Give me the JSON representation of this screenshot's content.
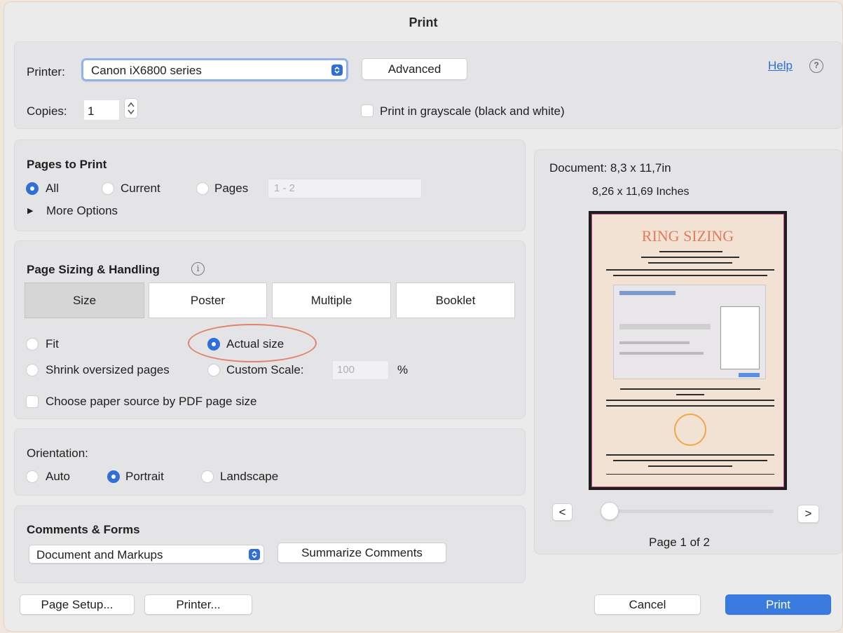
{
  "title": "Print",
  "printer": {
    "label": "Printer:",
    "value": "Canon iX6800 series",
    "advanced_label": "Advanced",
    "help_label": "Help",
    "help_icon": "question-circle-icon"
  },
  "copies": {
    "label": "Copies:",
    "value": "1",
    "grayscale_label": "Print in grayscale (black and white)",
    "grayscale_checked": false
  },
  "pages_to_print": {
    "heading": "Pages to Print",
    "all_label": "All",
    "current_label": "Current",
    "pages_label": "Pages",
    "pages_range": "1 - 2",
    "selected": "All",
    "more_options_label": "More Options"
  },
  "sizing": {
    "heading": "Page Sizing & Handling",
    "info_icon": "info-icon",
    "tabs": [
      "Size",
      "Poster",
      "Multiple",
      "Booklet"
    ],
    "active_tab": "Size",
    "fit_label": "Fit",
    "actual_size_label": "Actual size",
    "shrink_label": "Shrink oversized pages",
    "custom_scale_label": "Custom Scale:",
    "custom_scale_value": "100",
    "percent_label": "%",
    "selected": "Actual size",
    "paper_source_label": "Choose paper source by PDF page size",
    "paper_source_checked": false,
    "highlight_color": "#e0836a"
  },
  "orientation": {
    "label": "Orientation:",
    "auto_label": "Auto",
    "portrait_label": "Portrait",
    "landscape_label": "Landscape",
    "selected": "Portrait"
  },
  "comments": {
    "heading": "Comments & Forms",
    "value": "Document and Markups",
    "summarize_label": "Summarize Comments"
  },
  "preview": {
    "document_label": "Document: 8,3 x 11,7in",
    "size_label": "8,26 x 11,69 Inches",
    "page_label": "Page 1 of 2",
    "prev_label": "<",
    "next_label": ">",
    "thumbnail_title": "RING SIZING",
    "slider_position": 0
  },
  "footer": {
    "page_setup_label": "Page Setup...",
    "printer_label": "Printer...",
    "cancel_label": "Cancel",
    "print_label": "Print"
  },
  "colors": {
    "accent": "#2f6fd6",
    "print_button": "#3a7be0",
    "help_link": "#2f6fd6"
  }
}
